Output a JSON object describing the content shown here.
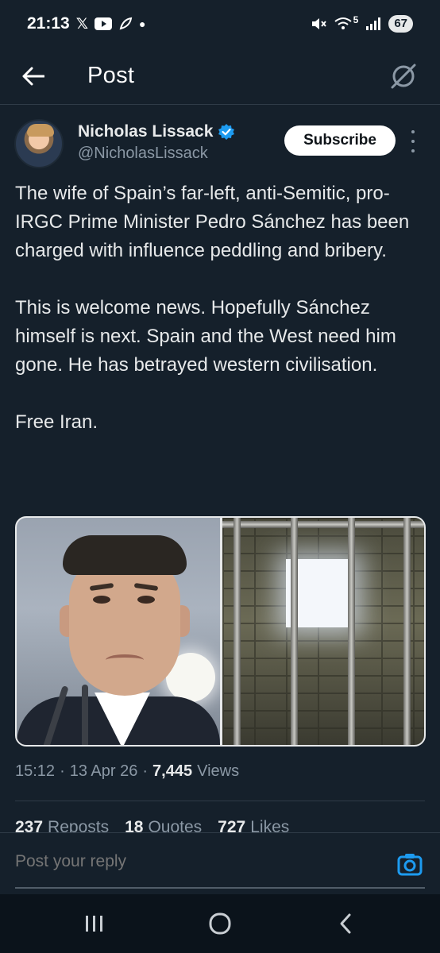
{
  "status_bar": {
    "time": "21:13",
    "icons_left": [
      "x-icon",
      "youtube-icon",
      "feather-icon",
      "dot-icon"
    ],
    "signal_label": "5",
    "battery": "67"
  },
  "header": {
    "title": "Post"
  },
  "author": {
    "name": "Nicholas Lissack",
    "handle": "@NicholasLissack",
    "verified": true,
    "subscribe_label": "Subscribe"
  },
  "post": {
    "paragraphs": [
      "The wife of Spain’s far-left, anti-Semitic, pro-IRGC Prime Minister Pedro Sánchez has been charged with influence peddling and bribery.",
      "This is welcome news. Hopefully Sánchez himself is next. Spain and the West need him gone. He has betrayed western civilisation.",
      "Free Iran."
    ]
  },
  "meta": {
    "time": "15:12",
    "date": "13 Apr 26",
    "views_count": "7,445",
    "views_label": "Views",
    "separator": "·"
  },
  "stats": {
    "reposts_count": "237",
    "reposts_label": "Reposts",
    "quotes_count": "18",
    "quotes_label": "Quotes",
    "likes_count": "727",
    "likes_label": "Likes"
  },
  "reply": {
    "placeholder": "Post your reply"
  },
  "colors": {
    "background": "#15202b",
    "accent": "#1d9bf0",
    "muted": "#8b98a5"
  }
}
